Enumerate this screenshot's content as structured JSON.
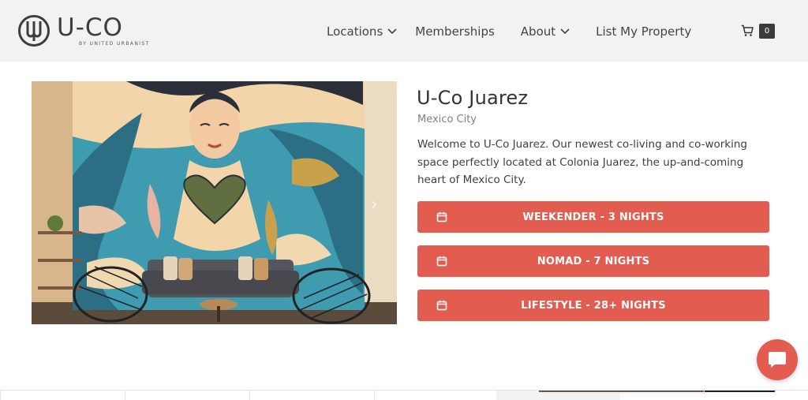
{
  "header": {
    "logo": {
      "word": "U-CO",
      "subtitle": "BY UNITED URBANIST"
    },
    "nav": [
      {
        "label": "Locations",
        "has_dropdown": true
      },
      {
        "label": "Memberships",
        "has_dropdown": false
      },
      {
        "label": "About",
        "has_dropdown": true
      },
      {
        "label": "List My Property",
        "has_dropdown": false
      }
    ],
    "cart": {
      "icon": "cart-icon",
      "count": "0"
    }
  },
  "property": {
    "title": "U-Co Juarez",
    "city": "Mexico City",
    "description": "Welcome to U-Co Juarez. Our newest co-living and co-working space perfectly located at Colonia Juarez, the up-and-coming heart of Mexico City.",
    "photo": {
      "icon": "mural-lounge-photo",
      "next_arrow": "›"
    }
  },
  "booking_options": [
    {
      "label": "WEEKENDER - 3 NIGHTS",
      "icon": "calendar-icon"
    },
    {
      "label": "NOMAD - 7 NIGHTS",
      "icon": "calendar-icon"
    },
    {
      "label": "LIFESTYLE - 28+ NIGHTS",
      "icon": "calendar-icon"
    }
  ],
  "chat": {
    "icon": "chat-bubble-icon"
  },
  "colors": {
    "accent": "#e25c50",
    "header_bg": "#f1f2f4",
    "text": "#3a3a3a"
  }
}
